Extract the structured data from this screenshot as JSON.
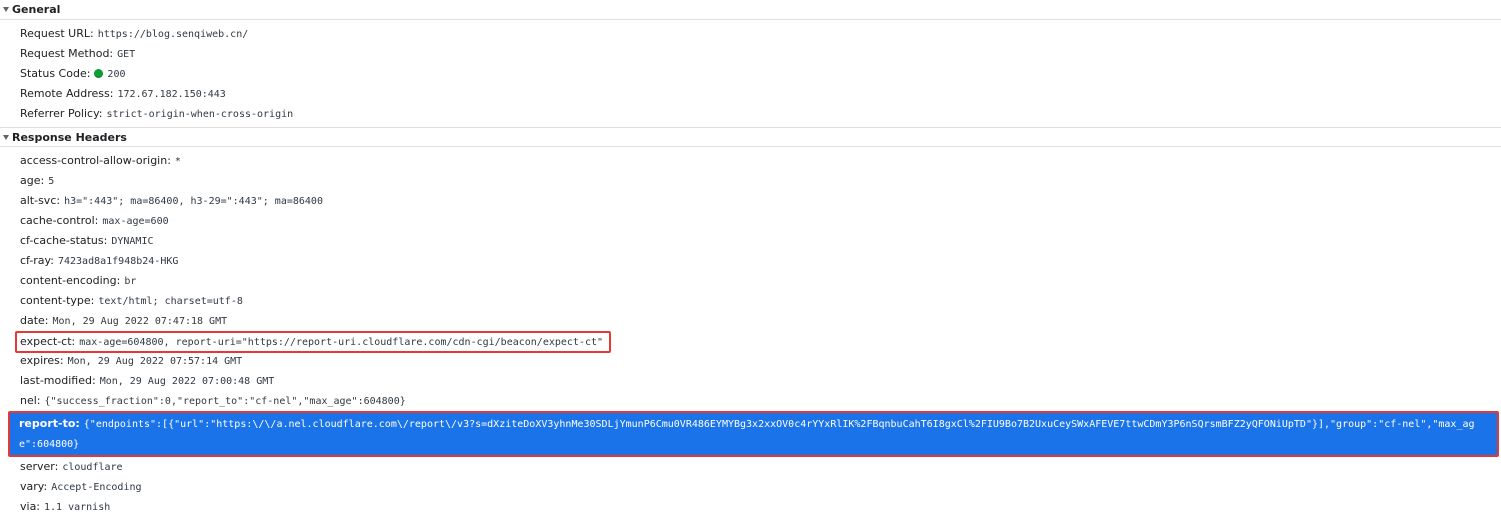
{
  "general": {
    "title": "General",
    "rows": [
      {
        "name": "Request URL:",
        "value": "https://blog.senqiweb.cn/"
      },
      {
        "name": "Request Method:",
        "value": "GET"
      },
      {
        "name": "Status Code:",
        "value": "200"
      },
      {
        "name": "Remote Address:",
        "value": "172.67.182.150:443"
      },
      {
        "name": "Referrer Policy:",
        "value": "strict-origin-when-cross-origin"
      }
    ]
  },
  "response": {
    "title": "Response Headers",
    "rows": [
      {
        "name": "access-control-allow-origin:",
        "value": "*"
      },
      {
        "name": "age:",
        "value": "5"
      },
      {
        "name": "alt-svc:",
        "value": "h3=\":443\"; ma=86400, h3-29=\":443\"; ma=86400"
      },
      {
        "name": "cache-control:",
        "value": "max-age=600"
      },
      {
        "name": "cf-cache-status:",
        "value": "DYNAMIC"
      },
      {
        "name": "cf-ray:",
        "value": "7423ad8a1f948b24-HKG"
      },
      {
        "name": "content-encoding:",
        "value": "br"
      },
      {
        "name": "content-type:",
        "value": "text/html; charset=utf-8"
      },
      {
        "name": "date:",
        "value": "Mon, 29 Aug 2022 07:47:18 GMT"
      },
      {
        "name": "expect-ct:",
        "value": "max-age=604800, report-uri=\"https://report-uri.cloudflare.com/cdn-cgi/beacon/expect-ct\""
      },
      {
        "name": "expires:",
        "value": "Mon, 29 Aug 2022 07:57:14 GMT"
      },
      {
        "name": "last-modified:",
        "value": "Mon, 29 Aug 2022 07:00:48 GMT"
      },
      {
        "name": "nel:",
        "value": "{\"success_fraction\":0,\"report_to\":\"cf-nel\",\"max_age\":604800}"
      },
      {
        "name": "report-to:",
        "value": "{\"endpoints\":[{\"url\":\"https:\\/\\/a.nel.cloudflare.com\\/report\\/v3?s=dXziteDoXV3yhnMe30SDLjYmunP6Cmu0VR486EYMYBg3x2xxOV0c4rYYxRlIK%2FBqnbuCahT6I8gxCl%2FIU9Bo7B2UxuCeySWxAFEVE7ttwCDmY3P6nSQrsmBFZ2yQFONiUpTD\"}],\"group\":\"cf-nel\",\"max_age\":604800}"
      },
      {
        "name": "server:",
        "value": "cloudflare"
      },
      {
        "name": "vary:",
        "value": "Accept-Encoding"
      },
      {
        "name": "via:",
        "value": "1.1 varnish"
      }
    ]
  },
  "colors": {
    "status_ok": "#0d9e36",
    "selection": "#1a73e8",
    "highlight_outline": "#e53935"
  }
}
